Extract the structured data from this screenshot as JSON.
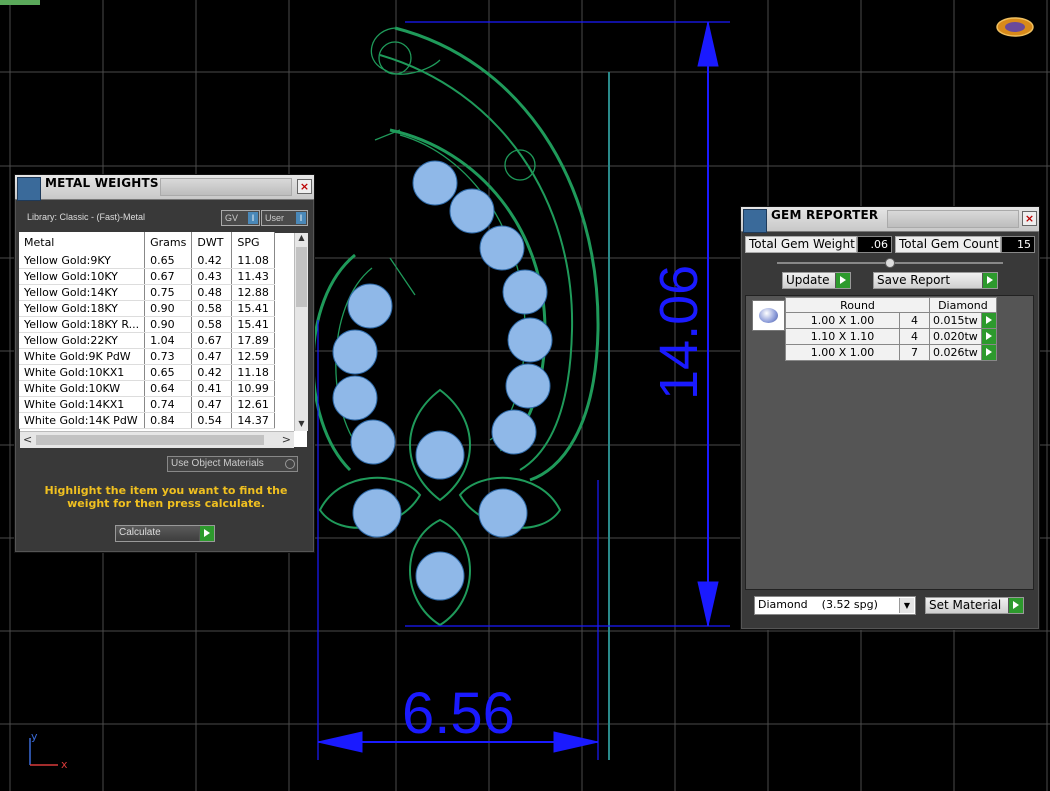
{
  "metal_weights": {
    "title": "METAL WEIGHTS",
    "library": "Library: Classic - (Fast)-Metal",
    "gv_label": "GV",
    "user_label": "User",
    "columns": [
      "Metal",
      "Grams",
      "DWT",
      "SPG"
    ],
    "rows": [
      {
        "metal": "Yellow Gold:9KY",
        "grams": "0.65",
        "dwt": "0.42",
        "spg": "11.08"
      },
      {
        "metal": "Yellow Gold:10KY",
        "grams": "0.67",
        "dwt": "0.43",
        "spg": "11.43"
      },
      {
        "metal": "Yellow Gold:14KY",
        "grams": "0.75",
        "dwt": "0.48",
        "spg": "12.88"
      },
      {
        "metal": "Yellow Gold:18KY",
        "grams": "0.90",
        "dwt": "0.58",
        "spg": "15.41"
      },
      {
        "metal": "Yellow Gold:18KY R...",
        "grams": "0.90",
        "dwt": "0.58",
        "spg": "15.41"
      },
      {
        "metal": "Yellow Gold:22KY",
        "grams": "1.04",
        "dwt": "0.67",
        "spg": "17.89"
      },
      {
        "metal": "White Gold:9K PdW",
        "grams": "0.73",
        "dwt": "0.47",
        "spg": "12.59"
      },
      {
        "metal": "White Gold:10KX1",
        "grams": "0.65",
        "dwt": "0.42",
        "spg": "11.18"
      },
      {
        "metal": "White Gold:10KW",
        "grams": "0.64",
        "dwt": "0.41",
        "spg": "10.99"
      },
      {
        "metal": "White Gold:14KX1",
        "grams": "0.74",
        "dwt": "0.47",
        "spg": "12.61"
      },
      {
        "metal": "White Gold:14K PdW",
        "grams": "0.84",
        "dwt": "0.54",
        "spg": "14.37"
      }
    ],
    "use_object_materials": "Use Object Materials",
    "instruction": "Highlight the item you want to find the weight for then press calculate.",
    "calculate": "Calculate"
  },
  "gem_reporter": {
    "title": "GEM REPORTER",
    "total_weight_label": "Total Gem Weight",
    "total_weight_value": ".06",
    "total_count_label": "Total Gem Count",
    "total_count_value": "15",
    "update": "Update",
    "save_report": "Save Report",
    "col_shape": "Round",
    "col_material": "Diamond",
    "rows": [
      {
        "size": "1.00 X 1.00",
        "count": "4",
        "weight": "0.015tw"
      },
      {
        "size": "1.10 X 1.10",
        "count": "4",
        "weight": "0.020tw"
      },
      {
        "size": "1.00 X 1.00",
        "count": "7",
        "weight": "0.026tw"
      }
    ],
    "material_select": "Diamond    (3.52 spg)",
    "set_material": "Set Material"
  },
  "viewport": {
    "dim_height": "14.06",
    "dim_width": "6.56",
    "axis_y": "y",
    "axis_x": "x"
  },
  "colors": {
    "grid": "#4a4a4a",
    "wire": "#1f9a5a",
    "gem": "#8fb8e8",
    "dimension": "#1a1aff",
    "instruction": "#f0c020"
  }
}
